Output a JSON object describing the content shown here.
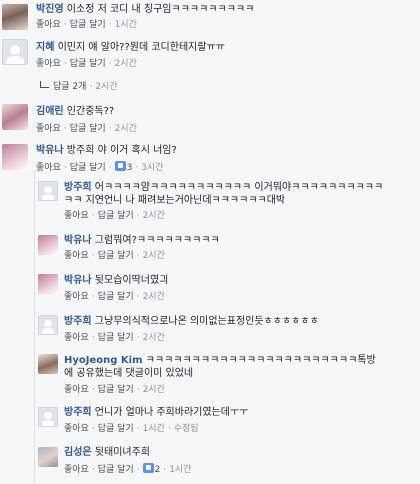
{
  "actions": {
    "like": "좋아요",
    "reply": "답글 달기",
    "edited": "수정됨",
    "sep": "·"
  },
  "comments": [
    {
      "author": "박진영",
      "text": "이소정 저 코디 내 칭구임ㅋㅋㅋㅋㅋㅋㅋㅋㅋ",
      "time": "1시간",
      "avatar": "photo"
    },
    {
      "author": "지혜",
      "text": "이민지 얘 알아??뭔데 코디한테지랄ㅠㅠ",
      "time": "2시간",
      "avatar": "blank",
      "replies_link": "답글 2개",
      "replies_time": "2시간"
    },
    {
      "author": "김애린",
      "text": "인간중독??",
      "time": "2시간",
      "avatar": "photo"
    },
    {
      "author": "박유나",
      "text": "방주희 야 이거 혹시 너임?",
      "time": "3시간",
      "likes": "3",
      "avatar": "photo"
    }
  ],
  "replies": [
    {
      "author": "방주희",
      "text_line1": "어ㅋㅋㅋㅋ얌ㅋㅋㅋㅋㅋㅋㅋㅋㅋㅋㅋ 이거뭐야ㅋㅋㅋㅋㅋㅋㅋㅋㅋㅋ",
      "text_line2": "ㅋㅋ 지연언니 나 패려보는거아닌데ㅋㅋㅋㅋㅋㅋ대박",
      "time": "2시간",
      "avatar": "blank"
    },
    {
      "author": "박유나",
      "text": "그럼뭐여?ㅋㅋㅋㅋㅋㅋㅋㅋㅋ",
      "time": "2시간",
      "avatar": "photo"
    },
    {
      "author": "박유나",
      "text": "뒷모습이딱너였긔",
      "time": "2시간",
      "avatar": "photo"
    },
    {
      "author": "방주희",
      "text": "그냥무의식적으로나온 의미없는표정인듯ㅎㅎㅎㅎㅎㅎ",
      "time": "2시간",
      "avatar": "blank"
    },
    {
      "author": "HyoJeong Kim",
      "text_line1": "ㅋㅋㅋㅋㅋㅋㅋㅋㅋㅋㅋㅋㅋㅋㅋㅋㅋㅋㅋㅋㅋㅋㅋ톡방",
      "text_line2": "에 공유했는데 댓글이미 있었네",
      "time": "2시간",
      "avatar": "photo"
    },
    {
      "author": "방주희",
      "text": "언니가 얼마나 주희바라기였는데ㅜㅜ",
      "time": "1시간",
      "avatar": "blank",
      "edited": true
    },
    {
      "author": "김성은",
      "text": "뒷태미녀주희",
      "time": "1시간",
      "likes": "2",
      "avatar": "photo"
    }
  ]
}
